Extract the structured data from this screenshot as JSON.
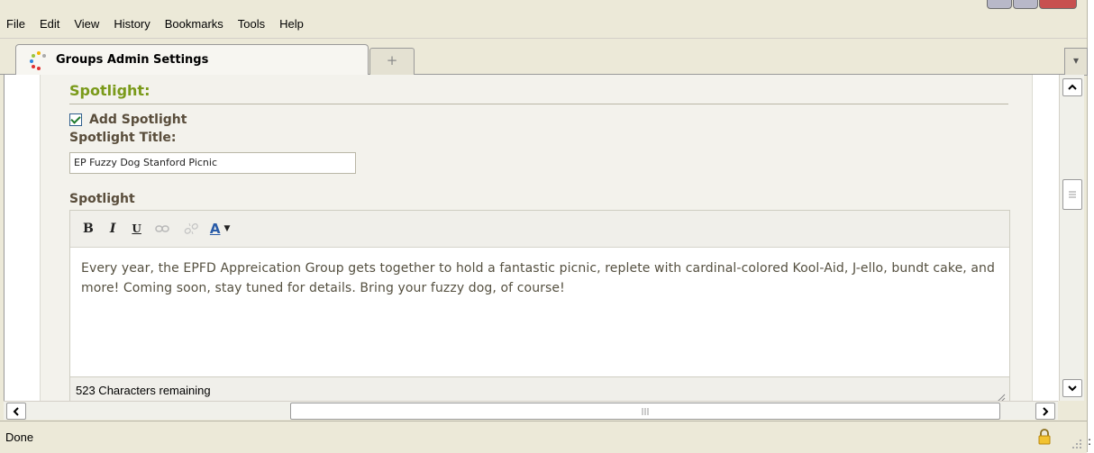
{
  "menubar": {
    "items": [
      "File",
      "Edit",
      "View",
      "History",
      "Bookmarks",
      "Tools",
      "Help"
    ]
  },
  "tabs": {
    "active_title": "Groups Admin Settings",
    "new_tab_glyph": "+",
    "list_glyph": "▾"
  },
  "page": {
    "section_title": "Spotlight:",
    "add_spotlight_label": "Add Spotlight",
    "add_spotlight_checked": true,
    "spotlight_title_label": "Spotlight Title:",
    "spotlight_title_value": "EP Fuzzy Dog Stanford Picnic",
    "spotlight_label": "Spotlight",
    "editor": {
      "toolbar": {
        "bold": "B",
        "italic": "I",
        "underline": "U",
        "font_color": "A",
        "icons": [
          "link-icon",
          "unlink-icon",
          "font-color-icon"
        ]
      },
      "body_text": "Every year, the EPFD Appreication Group gets together to hold a fantastic picnic, replete with cardinal-colored Kool-Aid, J-ello, bundt cake, and more! Coming soon, stay tuned for details. Bring your fuzzy dog, of course!",
      "footer_text": "523 Characters remaining"
    }
  },
  "statusbar": {
    "text": "Done",
    "edge_glyph": ":"
  },
  "colors": {
    "section_title": "#7a9a1a",
    "label": "#594d3b",
    "checkbox_check": "#1f7a2c",
    "font_color_accent": "#2a5ca8"
  }
}
